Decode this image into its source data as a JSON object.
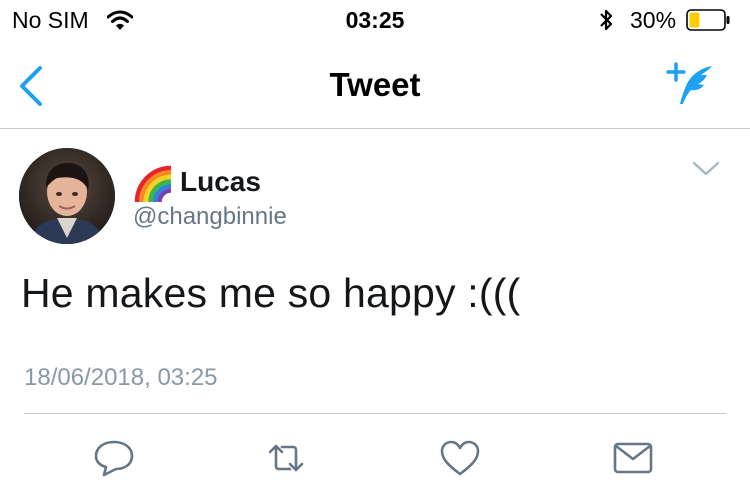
{
  "status_bar": {
    "carrier": "No SIM",
    "time": "03:25",
    "battery_percent": "30%",
    "battery_level": 0.3,
    "icons": [
      "wifi-icon",
      "bluetooth-icon",
      "battery-icon"
    ]
  },
  "nav": {
    "title": "Tweet",
    "back_icon": "chevron-left-icon",
    "compose_icon": "compose-tweet-icon"
  },
  "tweet": {
    "display_name": "Lucas",
    "name_emoji": "rainbow",
    "handle": "@changbinnie",
    "text": "He makes me so happy :(((",
    "timestamp": "18/06/2018, 03:25",
    "menu_icon": "chevron-down-icon"
  },
  "actions": [
    "reply-icon",
    "retweet-icon",
    "like-icon",
    "direct-message-icon"
  ],
  "colors": {
    "accent": "#1da1f2",
    "secondary_text": "#657786",
    "timestamp_text": "#8899a6",
    "icon_gray": "#657786",
    "battery_fill": "#ffcc00"
  }
}
